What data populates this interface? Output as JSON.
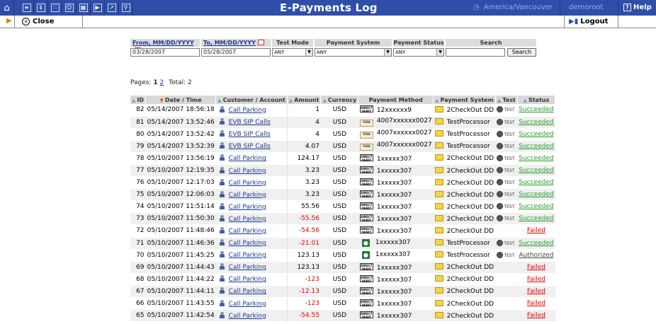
{
  "topbar": {
    "icons": [
      "home-icon",
      "list-icon",
      "dollar-icon",
      "grid-icon",
      "person-icon",
      "accounts-icon",
      "forward-icon",
      "chart-icon",
      "search-icon"
    ],
    "title": "E-Payments Log",
    "timezone": "America/Vancouver",
    "user": "demoroot",
    "help": "Help"
  },
  "toolbar": {
    "close_label": "Close",
    "logout_label": "Logout"
  },
  "filters": {
    "from_label": "From, MM/DD/YYYY",
    "to_label": "To, MM/DD/YYYY",
    "test_mode_label": "Test Mode",
    "payment_system_label": "Payment System",
    "payment_status_label": "Payment Status",
    "search_label": "Search",
    "from_value": "03/28/2007",
    "to_value": "05/28/2007",
    "test_mode_value": "ANY",
    "payment_system_value": "ANY",
    "payment_status_value": "ANY",
    "search_value": "",
    "search_button": "Search"
  },
  "pager": {
    "label": "Pages:",
    "current": "1",
    "other": "2",
    "total": "Total: 2"
  },
  "table": {
    "headers": {
      "id": "ID",
      "datetime": "Date / Time",
      "customer": "Customer / Account",
      "amount": "Amount",
      "currency": "Currency",
      "method": "Payment Method",
      "system": "Payment System",
      "test": "Test",
      "status": "Status"
    },
    "test_icon_label": "TEST",
    "rows": [
      {
        "id": "82",
        "datetime": "05/14/2007 18:56:18",
        "customer": "Call Parking",
        "amount": "1",
        "neg": false,
        "currency": "USD",
        "method_icon": "direct-debit",
        "method": "12xxxxxx9",
        "system": "2CheckOut DD",
        "test": true,
        "status": "Succeeded",
        "status_type": "ok"
      },
      {
        "id": "81",
        "datetime": "05/14/2007 13:52:46",
        "customer": "EVB SIP Calls",
        "amount": "4",
        "neg": false,
        "currency": "USD",
        "method_icon": "card",
        "method": "4007xxxxxx0027",
        "system": "TestProcessor",
        "test": true,
        "status": "Succeeded",
        "status_type": "ok"
      },
      {
        "id": "80",
        "datetime": "05/14/2007 13:52:42",
        "customer": "EVB SIP Calls",
        "amount": "4",
        "neg": false,
        "currency": "USD",
        "method_icon": "card",
        "method": "4007xxxxxx0027",
        "system": "TestProcessor",
        "test": true,
        "status": "Succeeded",
        "status_type": "ok"
      },
      {
        "id": "79",
        "datetime": "05/14/2007 13:52:39",
        "customer": "EVB SIP Calls",
        "amount": "4.07",
        "neg": false,
        "currency": "USD",
        "method_icon": "card",
        "method": "4007xxxxxx0027",
        "system": "TestProcessor",
        "test": true,
        "status": "Succeeded",
        "status_type": "ok"
      },
      {
        "id": "78",
        "datetime": "05/10/2007 13:56:19",
        "customer": "Call Parking",
        "amount": "124.17",
        "neg": false,
        "currency": "USD",
        "method_icon": "direct-debit",
        "method": "1xxxxx307",
        "system": "2CheckOut DD",
        "test": true,
        "status": "Succeeded",
        "status_type": "ok"
      },
      {
        "id": "77",
        "datetime": "05/10/2007 12:19:35",
        "customer": "Call Parking",
        "amount": "3.23",
        "neg": false,
        "currency": "USD",
        "method_icon": "direct-debit",
        "method": "1xxxxx307",
        "system": "2CheckOut DD",
        "test": true,
        "status": "Succeeded",
        "status_type": "ok"
      },
      {
        "id": "76",
        "datetime": "05/10/2007 12:17:03",
        "customer": "Call Parking",
        "amount": "3.23",
        "neg": false,
        "currency": "USD",
        "method_icon": "direct-debit",
        "method": "1xxxxx307",
        "system": "2CheckOut DD",
        "test": true,
        "status": "Succeeded",
        "status_type": "ok"
      },
      {
        "id": "75",
        "datetime": "05/10/2007 12:06:03",
        "customer": "Call Parking",
        "amount": "3.23",
        "neg": false,
        "currency": "USD",
        "method_icon": "direct-debit",
        "method": "1xxxxx307",
        "system": "2CheckOut DD",
        "test": true,
        "status": "Succeeded",
        "status_type": "ok"
      },
      {
        "id": "74",
        "datetime": "05/10/2007 11:51:14",
        "customer": "Call Parking",
        "amount": "55.56",
        "neg": false,
        "currency": "USD",
        "method_icon": "direct-debit",
        "method": "1xxxxx307",
        "system": "2CheckOut DD",
        "test": true,
        "status": "Succeeded",
        "status_type": "ok"
      },
      {
        "id": "73",
        "datetime": "05/10/2007 11:50:30",
        "customer": "Call Parking",
        "amount": "-55.56",
        "neg": true,
        "currency": "USD",
        "method_icon": "direct-debit",
        "method": "1xxxxx307",
        "system": "2CheckOut DD",
        "test": true,
        "status": "Succeeded",
        "status_type": "ok"
      },
      {
        "id": "72",
        "datetime": "05/10/2007 11:48:46",
        "customer": "Call Parking",
        "amount": "-54.56",
        "neg": true,
        "currency": "USD",
        "method_icon": "direct-debit",
        "method": "1xxxxx307",
        "system": "2CheckOut DD",
        "test": false,
        "status": "Failed",
        "status_type": "fail"
      },
      {
        "id": "71",
        "datetime": "05/10/2007 11:46:36",
        "customer": "Call Parking",
        "amount": "-21.01",
        "neg": true,
        "currency": "USD",
        "method_icon": "bank",
        "method": "1xxxxx307",
        "system": "TestProcessor",
        "test": true,
        "status": "Succeeded",
        "status_type": "ok"
      },
      {
        "id": "70",
        "datetime": "05/10/2007 11:45:25",
        "customer": "Call Parking",
        "amount": "123.13",
        "neg": false,
        "currency": "USD",
        "method_icon": "bank",
        "method": "1xxxxx307",
        "system": "TestProcessor",
        "test": true,
        "status": "Authorized",
        "status_type": "auth"
      },
      {
        "id": "69",
        "datetime": "05/10/2007 11:44:43",
        "customer": "Call Parking",
        "amount": "123.13",
        "neg": false,
        "currency": "USD",
        "method_icon": "direct-debit",
        "method": "1xxxxx307",
        "system": "2CheckOut DD",
        "test": false,
        "status": "Failed",
        "status_type": "fail"
      },
      {
        "id": "68",
        "datetime": "05/10/2007 11:44:22",
        "customer": "Call Parking",
        "amount": "-123",
        "neg": true,
        "currency": "USD",
        "method_icon": "direct-debit",
        "method": "1xxxxx307",
        "system": "2CheckOut DD",
        "test": false,
        "status": "Failed",
        "status_type": "fail"
      },
      {
        "id": "67",
        "datetime": "05/10/2007 11:44:11",
        "customer": "Call Parking",
        "amount": "-12.13",
        "neg": true,
        "currency": "USD",
        "method_icon": "direct-debit",
        "method": "1xxxxx307",
        "system": "2CheckOut DD",
        "test": false,
        "status": "Failed",
        "status_type": "fail"
      },
      {
        "id": "66",
        "datetime": "05/10/2007 11:43:55",
        "customer": "Call Parking",
        "amount": "-123",
        "neg": true,
        "currency": "USD",
        "method_icon": "direct-debit",
        "method": "1xxxxx307",
        "system": "2CheckOut DD",
        "test": false,
        "status": "Failed",
        "status_type": "fail"
      },
      {
        "id": "65",
        "datetime": "05/10/2007 11:42:54",
        "customer": "Call Parking",
        "amount": "-54.55",
        "neg": true,
        "currency": "USD",
        "method_icon": "direct-debit",
        "method": "1xxxxx307",
        "system": "2CheckOut DD",
        "test": false,
        "status": "Failed",
        "status_type": "fail"
      }
    ]
  }
}
